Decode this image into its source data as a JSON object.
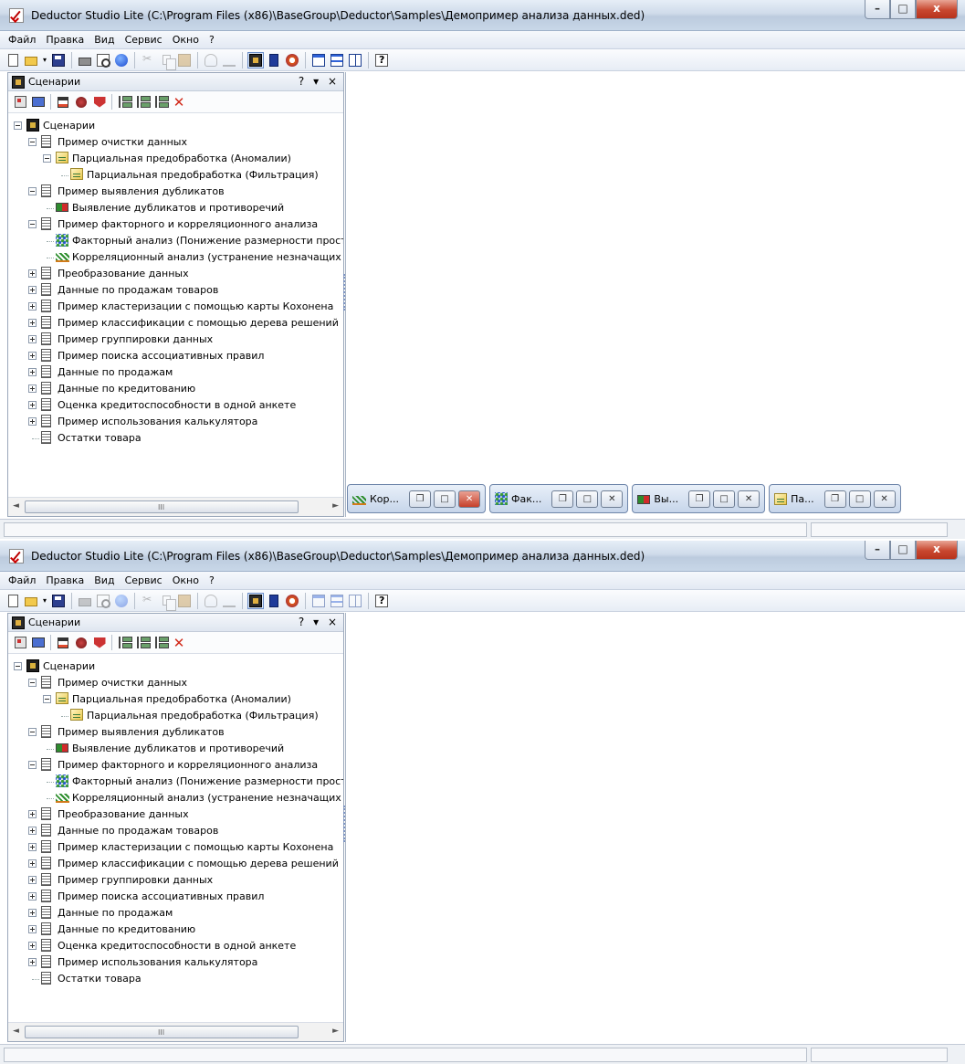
{
  "app": {
    "title": "Deductor Studio Lite (C:\\Program Files (x86)\\BaseGroup\\Deductor\\Samples\\Демопример анализа данных.ded)"
  },
  "window_buttons": {
    "minimize": "–",
    "maximize": "□",
    "close": "x"
  },
  "menu": [
    "Файл",
    "Правка",
    "Вид",
    "Сервис",
    "Окно",
    "?"
  ],
  "panel": {
    "title": "Сценарии",
    "controls": "? ▾ ×"
  },
  "tree": [
    {
      "label": "Сценарии",
      "level": 0,
      "expander": "minus",
      "icon": "scenario-root"
    },
    {
      "label": "Пример очистки данных",
      "level": 1,
      "expander": "minus",
      "icon": "script"
    },
    {
      "label": "Парциальная предобработка (Аномалии)",
      "level": 2,
      "expander": "minus",
      "icon": "filter"
    },
    {
      "label": "Парциальная предобработка (Фильтрация)",
      "level": 3,
      "expander": "none",
      "icon": "filter"
    },
    {
      "label": "Пример выявления дубликатов",
      "level": 1,
      "expander": "minus",
      "icon": "script"
    },
    {
      "label": "Выявление дубликатов и противоречий",
      "level": 2,
      "expander": "none",
      "icon": "duplicates"
    },
    {
      "label": "Пример факторного и корреляционного анализа",
      "level": 1,
      "expander": "minus",
      "icon": "script"
    },
    {
      "label": "Факторный анализ (Понижение размерности простран",
      "level": 2,
      "expander": "none",
      "icon": "factor"
    },
    {
      "label": "Корреляционный анализ (устранение незначащих факт",
      "level": 2,
      "expander": "none",
      "icon": "correlation"
    },
    {
      "label": "Преобразование данных",
      "level": 1,
      "expander": "plus",
      "icon": "script"
    },
    {
      "label": "Данные по продажам товаров",
      "level": 1,
      "expander": "plus",
      "icon": "script"
    },
    {
      "label": "Пример кластеризации с помощью карты Кохонена",
      "level": 1,
      "expander": "plus",
      "icon": "script"
    },
    {
      "label": "Пример классификации с помощью дерева решений",
      "level": 1,
      "expander": "plus",
      "icon": "script"
    },
    {
      "label": "Пример группировки данных",
      "level": 1,
      "expander": "plus",
      "icon": "script"
    },
    {
      "label": "Пример поиска ассоциативных правил",
      "level": 1,
      "expander": "plus",
      "icon": "script"
    },
    {
      "label": "Данные по продажам",
      "level": 1,
      "expander": "plus",
      "icon": "script"
    },
    {
      "label": "Данные по кредитованию",
      "level": 1,
      "expander": "plus",
      "icon": "script"
    },
    {
      "label": "Оценка кредитоспособности в одной анкете",
      "level": 1,
      "expander": "plus",
      "icon": "script"
    },
    {
      "label": "Пример использования калькулятора",
      "level": 1,
      "expander": "plus",
      "icon": "script"
    },
    {
      "label": "Остатки товара",
      "level": 1,
      "expander": "none",
      "icon": "script"
    }
  ],
  "minimized_windows": [
    {
      "label": "Кор...",
      "icon": "correlation",
      "close_active": true
    },
    {
      "label": "Фак...",
      "icon": "factor",
      "close_active": false
    },
    {
      "label": "Вы...",
      "icon": "duplicates",
      "close_active": false
    },
    {
      "label": "Па...",
      "icon": "filter",
      "close_active": false
    }
  ],
  "mini_buttons": {
    "restore": "❐",
    "maximize": "□",
    "close": "✕"
  },
  "scrollbar": {
    "left": "◄",
    "right": "►",
    "grip": "III"
  }
}
